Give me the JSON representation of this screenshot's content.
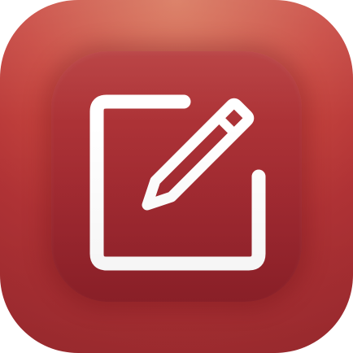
{
  "app_icon": {
    "icon": "compose-edit-icon",
    "colors": {
      "background_top": "#d8755a",
      "background_mid": "#c8473f",
      "background_bottom": "#9e2a2f",
      "plate_top": "#b63a3b",
      "plate_bottom": "#8f2029",
      "glyph": "#ffffff"
    }
  }
}
